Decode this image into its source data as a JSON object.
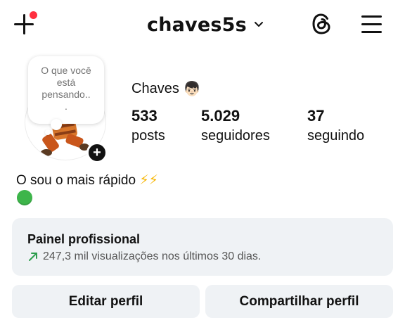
{
  "header": {
    "username": "chaves5s",
    "icons": {
      "new_post": "plus-icon",
      "notification": "red-dot",
      "account_switch": "chevron-down-icon",
      "threads": "threads-icon",
      "menu": "hamburger-menu-icon"
    },
    "notification_color": "#ff3040"
  },
  "note": {
    "placeholder": "O que você está pensando..",
    "dot": "."
  },
  "profile": {
    "display_name": "Chaves",
    "name_emoji": "👦🏻",
    "add_story_symbol": "+",
    "stats": [
      {
        "value": "533",
        "label": "posts"
      },
      {
        "value": "5.029",
        "label": "seguidores"
      },
      {
        "value": "37",
        "label": "seguindo"
      }
    ],
    "bio_text": "O sou o mais rápido",
    "bio_emoji": "⚡⚡",
    "bio_line2_emoji": "green-circle"
  },
  "dashboard": {
    "title": "Painel profissional",
    "subtitle": "247,3 mil visualizações nos últimos 30 dias.",
    "trend_color": "#2e9e4f"
  },
  "actions": {
    "edit": "Editar perfil",
    "share": "Compartilhar perfil"
  },
  "colors": {
    "button_bg": "#eff2f5",
    "text": "#111111",
    "muted": "#737373"
  }
}
